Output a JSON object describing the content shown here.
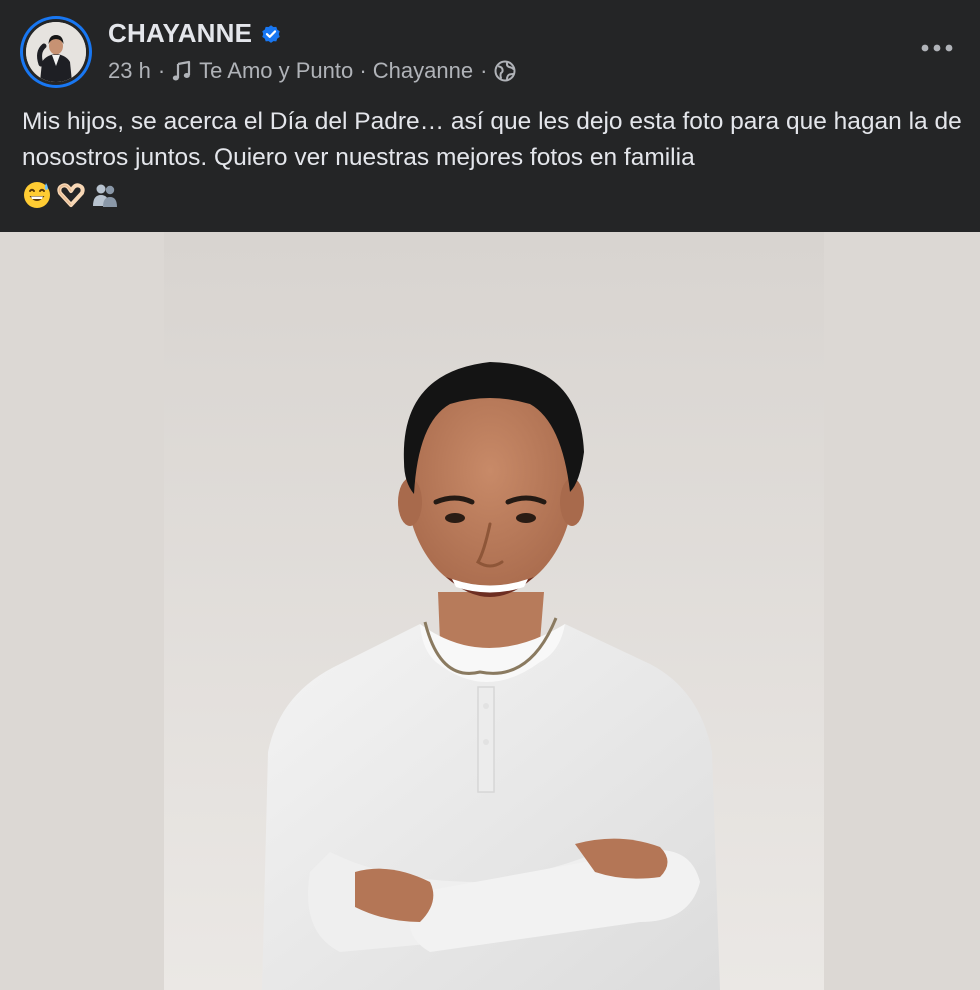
{
  "post": {
    "author_name": "CHAYANNE",
    "time": "23 h",
    "separator": "·",
    "song": "Te Amo y Punto · Chayanne",
    "caption": "Mis hijos, se acerca el Día del Padre… así que les dejo esta foto para que hagan la de nosostros juntos. Quiero ver nuestras mejores fotos en familia",
    "emojis": [
      "grinning-sweat-emoji",
      "heart-hands-emoji",
      "two-people-emoji"
    ]
  },
  "icons": {
    "verified": "verified-badge-icon",
    "music": "music-note-icon",
    "audience": "globe-icon",
    "more": "more-options-icon"
  },
  "colors": {
    "background": "#242526",
    "text_primary": "#e4e6eb",
    "text_secondary": "#b0b3b8",
    "accent": "#1877f2"
  }
}
